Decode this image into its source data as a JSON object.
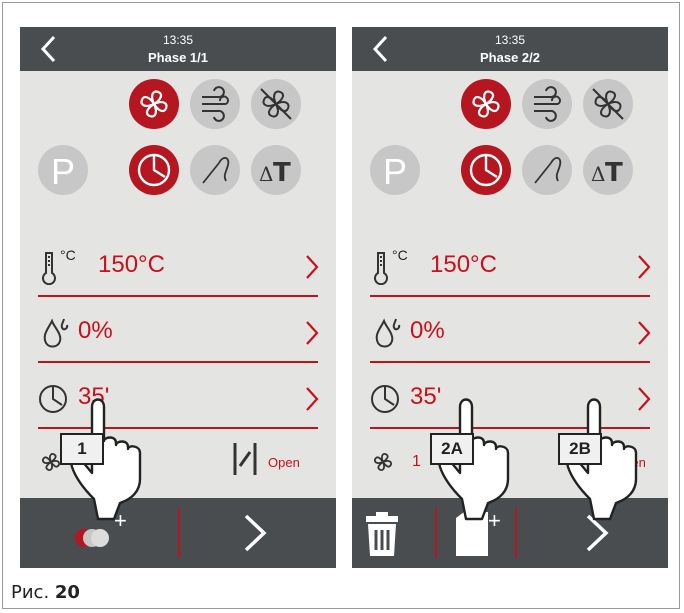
{
  "figure_caption_prefix": "Рис.",
  "figure_caption_number": "20",
  "screens": [
    {
      "time": "13:35",
      "title": "Phase 1/1",
      "p_label": "P",
      "temperature": {
        "unit": "°C",
        "value": "150°C"
      },
      "humidity": {
        "value": "0%"
      },
      "time_setting": {
        "value": "35'"
      },
      "fan_row": {
        "value": "1",
        "damper_label": "Open"
      },
      "bottom": {
        "add_symbol": "+"
      },
      "callouts": [
        "1"
      ]
    },
    {
      "time": "13:35",
      "title": "Phase 2/2",
      "p_label": "P",
      "temperature": {
        "unit": "°C",
        "value": "150°C"
      },
      "humidity": {
        "value": "0%"
      },
      "time_setting": {
        "value": "35'"
      },
      "fan_row": {
        "value": "1",
        "damper_label": "Open"
      },
      "bottom": {
        "add_symbol": "+"
      },
      "callouts": [
        "2A",
        "2B"
      ]
    }
  ],
  "colors": {
    "accent": "#b5161f",
    "header": "#4a4d50",
    "panel": "#e4e4e2",
    "inactive": "#c7c7c7"
  }
}
